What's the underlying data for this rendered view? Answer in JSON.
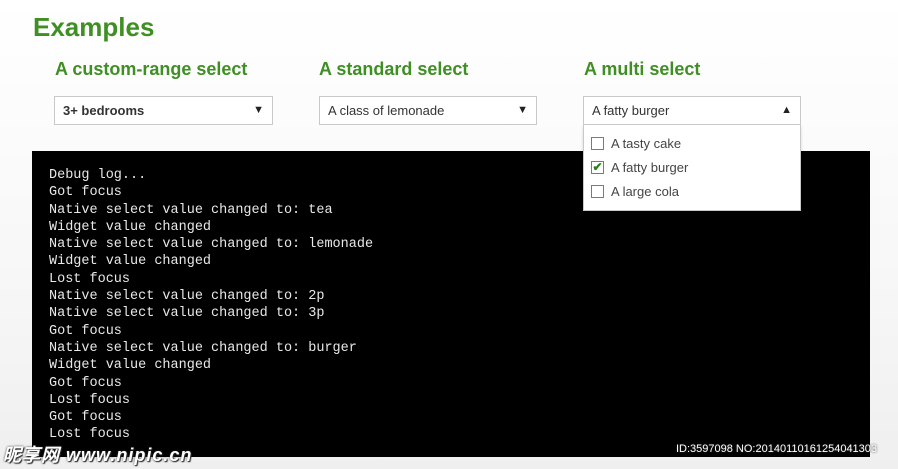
{
  "page": {
    "heading": "Examples"
  },
  "columns": [
    {
      "title": "A custom-range select",
      "value": "3+ bedrooms",
      "arrow": "▼"
    },
    {
      "title": "A standard select",
      "value": "A class of lemonade",
      "arrow": "▼"
    },
    {
      "title": "A multi select",
      "value": "A fatty burger",
      "arrow": "▲"
    }
  ],
  "multi_options": [
    {
      "label": "A tasty cake",
      "checked": false
    },
    {
      "label": "A fatty burger",
      "checked": true
    },
    {
      "label": "A large cola",
      "checked": false
    }
  ],
  "debug_log": [
    "Debug log...",
    "Got focus",
    "Native select value changed to: tea",
    "Widget value changed",
    "Native select value changed to: lemonade",
    "Widget value changed",
    "Lost focus",
    "Native select value changed to: 2p",
    "Native select value changed to: 3p",
    "Got focus",
    "Native select value changed to: burger",
    "Widget value changed",
    "Got focus",
    "Lost focus",
    "Got focus",
    "Lost focus"
  ],
  "watermark": {
    "left": "昵享网 www.nipic.cn",
    "right": "ID:3597098 NO:20140110161254041303"
  },
  "colors": {
    "accent_green": "#3f8f24",
    "console_bg": "#000000",
    "console_text": "#e8e8e8"
  }
}
